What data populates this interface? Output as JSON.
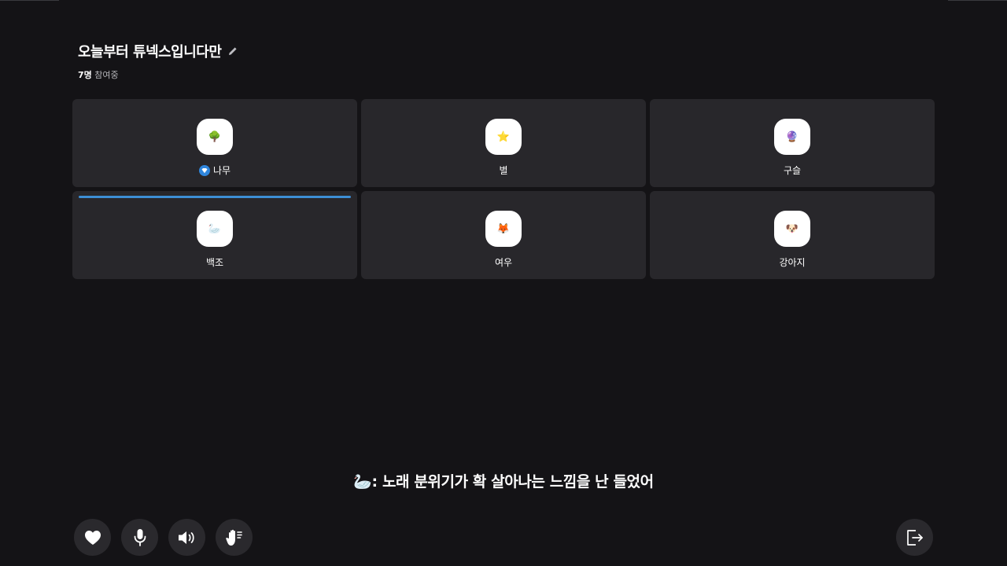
{
  "room": {
    "title": "오늘부터 튜넥스입니다만",
    "participant_count": "7명",
    "participant_suffix": "참여중"
  },
  "participants": [
    {
      "name": "나무",
      "emoji": "🌳",
      "host": true,
      "speaking": false
    },
    {
      "name": "별",
      "emoji": "⭐",
      "host": false,
      "speaking": false
    },
    {
      "name": "구슬",
      "emoji": "🔮",
      "host": false,
      "speaking": false
    },
    {
      "name": "백조",
      "emoji": "🦢",
      "host": false,
      "speaking": true
    },
    {
      "name": "여우",
      "emoji": "🦊",
      "host": false,
      "speaking": false
    },
    {
      "name": "강아지",
      "emoji": "🐶",
      "host": false,
      "speaking": false
    }
  ],
  "caption": {
    "speaker_emoji": "🦢",
    "separator": ":",
    "text": "노래 분위기가 확 살아나는 느낌을 난 들었어"
  },
  "controls": {
    "buttons": [
      "heart-icon",
      "microphone-icon",
      "speaker-icon",
      "raise-hand-icon"
    ],
    "exit": "exit-icon"
  },
  "colors": {
    "background": "#141316",
    "tile": "#28272b",
    "accent": "#3d8fd6",
    "host_badge": "#2f86dd"
  }
}
